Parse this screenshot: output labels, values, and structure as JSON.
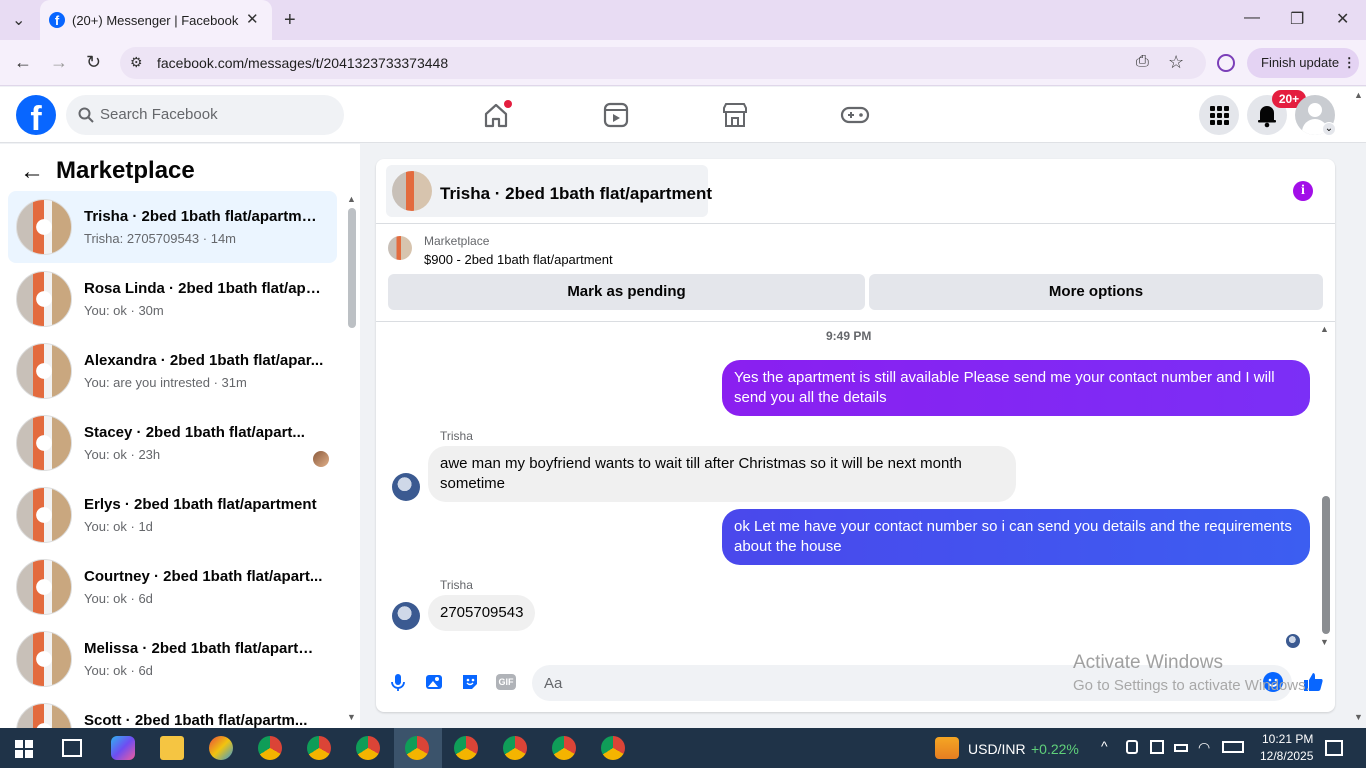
{
  "browser": {
    "tab_title": "(20+) Messenger | Facebook",
    "url": "facebook.com/messages/t/2041323733373448",
    "finish_update": "Finish update"
  },
  "header": {
    "search_placeholder": "Search Facebook",
    "notifications_badge": "20+"
  },
  "sidebar": {
    "title": "Marketplace",
    "conversations": [
      {
        "name": "Trisha · 2bed 1bath flat/apartment",
        "sub": "Trisha: 2705709543 · 14m"
      },
      {
        "name": "Rosa Linda · 2bed 1bath flat/apa...",
        "sub": "You: ok · 30m"
      },
      {
        "name": "Alexandra · 2bed 1bath flat/apar...",
        "sub": "You: are you intrested · 31m"
      },
      {
        "name": "Stacey · 2bed 1bath flat/apart...",
        "sub": "You: ok · 23h"
      },
      {
        "name": "Erlys · 2bed 1bath flat/apartment",
        "sub": "You: ok · 1d"
      },
      {
        "name": "Courtney · 2bed 1bath flat/apart...",
        "sub": "You: ok · 6d"
      },
      {
        "name": "Melissa · 2bed 1bath flat/apartm...",
        "sub": "You: ok · 6d"
      },
      {
        "name": "Scott · 2bed 1bath flat/apartm...",
        "sub": ""
      }
    ]
  },
  "chat": {
    "title": "Trisha · 2bed 1bath flat/apartment",
    "listing_label": "Marketplace",
    "listing_title": "$900 - 2bed 1bath flat/apartment",
    "mark_pending": "Mark as pending",
    "more_options": "More options",
    "timestamp": "9:49 PM",
    "messages": [
      {
        "from": "me",
        "text": "Yes the apartment is still available Please send me your contact number and I will send you all the details"
      },
      {
        "from": "Trisha",
        "text": "awe man my boyfriend wants to wait till after Christmas so it will be next month sometime"
      },
      {
        "from": "me",
        "text": "ok Let me have your contact number so i can send you details and the requirements about the house"
      },
      {
        "from": "Trisha",
        "text": "2705709543"
      }
    ],
    "composer_placeholder": "Aa",
    "gif_label": "GIF"
  },
  "watermark": {
    "line1": "Activate Windows",
    "line2": "Go to Settings to activate Windows."
  },
  "taskbar": {
    "ticker": "USD/INR",
    "change": "+0.22%",
    "time": "10:21 PM",
    "date": "12/8/2025"
  },
  "colors": {
    "fb_blue": "#0866ff",
    "bubble_purple": "#8a1ff0",
    "bubble_blue": "#3c5ef1",
    "taskbar": "#1f3348"
  }
}
